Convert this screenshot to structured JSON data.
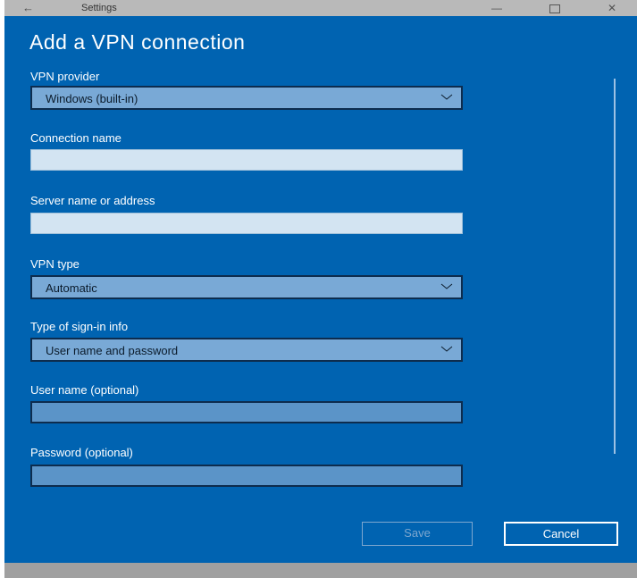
{
  "window": {
    "title": "Settings",
    "back_glyph": "←",
    "minimize_glyph": "—",
    "close_glyph": "✕"
  },
  "page": {
    "heading": "Add a VPN connection"
  },
  "form": {
    "vpn_provider": {
      "label": "VPN provider",
      "value": "Windows (built-in)"
    },
    "connection_name": {
      "label": "Connection name",
      "value": ""
    },
    "server_address": {
      "label": "Server name or address",
      "value": ""
    },
    "vpn_type": {
      "label": "VPN type",
      "value": "Automatic"
    },
    "signin_type": {
      "label": "Type of sign-in info",
      "value": "User name and password"
    },
    "username": {
      "label": "User name (optional)",
      "value": ""
    },
    "password": {
      "label": "Password (optional)",
      "value": ""
    }
  },
  "actions": {
    "save_label": "Save",
    "cancel_label": "Cancel"
  },
  "colors": {
    "background": "#0063b1",
    "titlebar": "#b9b9b9"
  }
}
